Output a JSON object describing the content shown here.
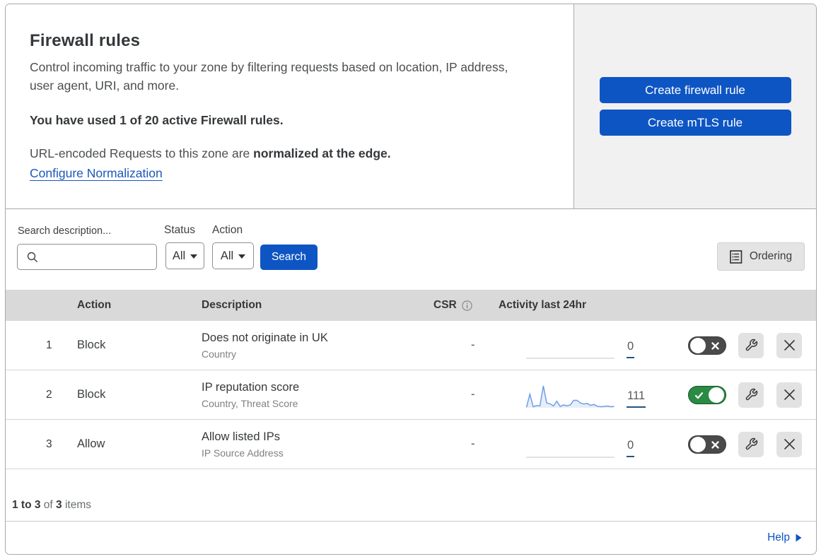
{
  "header": {
    "title": "Firewall rules",
    "description": "Control incoming traffic to your zone by filtering requests based on location, IP address, user agent, URI, and more.",
    "usage_notice": "You have used 1 of 20 active Firewall rules.",
    "normalization_text": "URL-encoded Requests to this zone are ",
    "normalization_bold": "normalized at the edge.",
    "normalization_link": "Configure Normalization",
    "create_firewall_button": "Create firewall rule",
    "create_mtls_button": "Create mTLS rule"
  },
  "filters": {
    "search_label": "Search description...",
    "status_label": "Status",
    "status_value": "All",
    "action_label": "Action",
    "action_value": "All",
    "search_button": "Search",
    "ordering_button": "Ordering"
  },
  "table": {
    "columns": {
      "action": "Action",
      "description": "Description",
      "csr": "CSR",
      "activity": "Activity last 24hr"
    },
    "rows": [
      {
        "num": "1",
        "action": "Block",
        "description": "Does not originate in UK",
        "fields": "Country",
        "csr": "-",
        "activity_count": "0",
        "enabled": false,
        "sparkline": []
      },
      {
        "num": "2",
        "action": "Block",
        "description": "IP reputation score",
        "fields": "Country, Threat Score",
        "csr": "-",
        "activity_count": "111",
        "enabled": true,
        "sparkline": [
          2,
          62,
          5,
          10,
          9,
          100,
          22,
          18,
          8,
          30,
          6,
          13,
          9,
          13,
          34,
          34,
          22,
          17,
          20,
          11,
          15,
          7,
          5,
          6,
          8,
          5,
          6
        ]
      },
      {
        "num": "3",
        "action": "Allow",
        "description": "Allow listed IPs",
        "fields": "IP Source Address",
        "csr": "-",
        "activity_count": "0",
        "enabled": false,
        "sparkline": []
      }
    ]
  },
  "footer": {
    "range": "1 to 3",
    "of_text": " of ",
    "total": "3",
    "items_text": " items",
    "help_label": "Help"
  },
  "colors": {
    "accent_blue": "#0e55c4",
    "link_blue": "#1d58b8",
    "toggle_on_green": "#2b8a44",
    "toggle_off_gray": "#4a4a4a",
    "table_header_gray": "#d9d9d9",
    "side_panel_gray": "#f1f1f1",
    "sparkline_blue": "#6d9ee8",
    "count_underline": "#26547d"
  }
}
